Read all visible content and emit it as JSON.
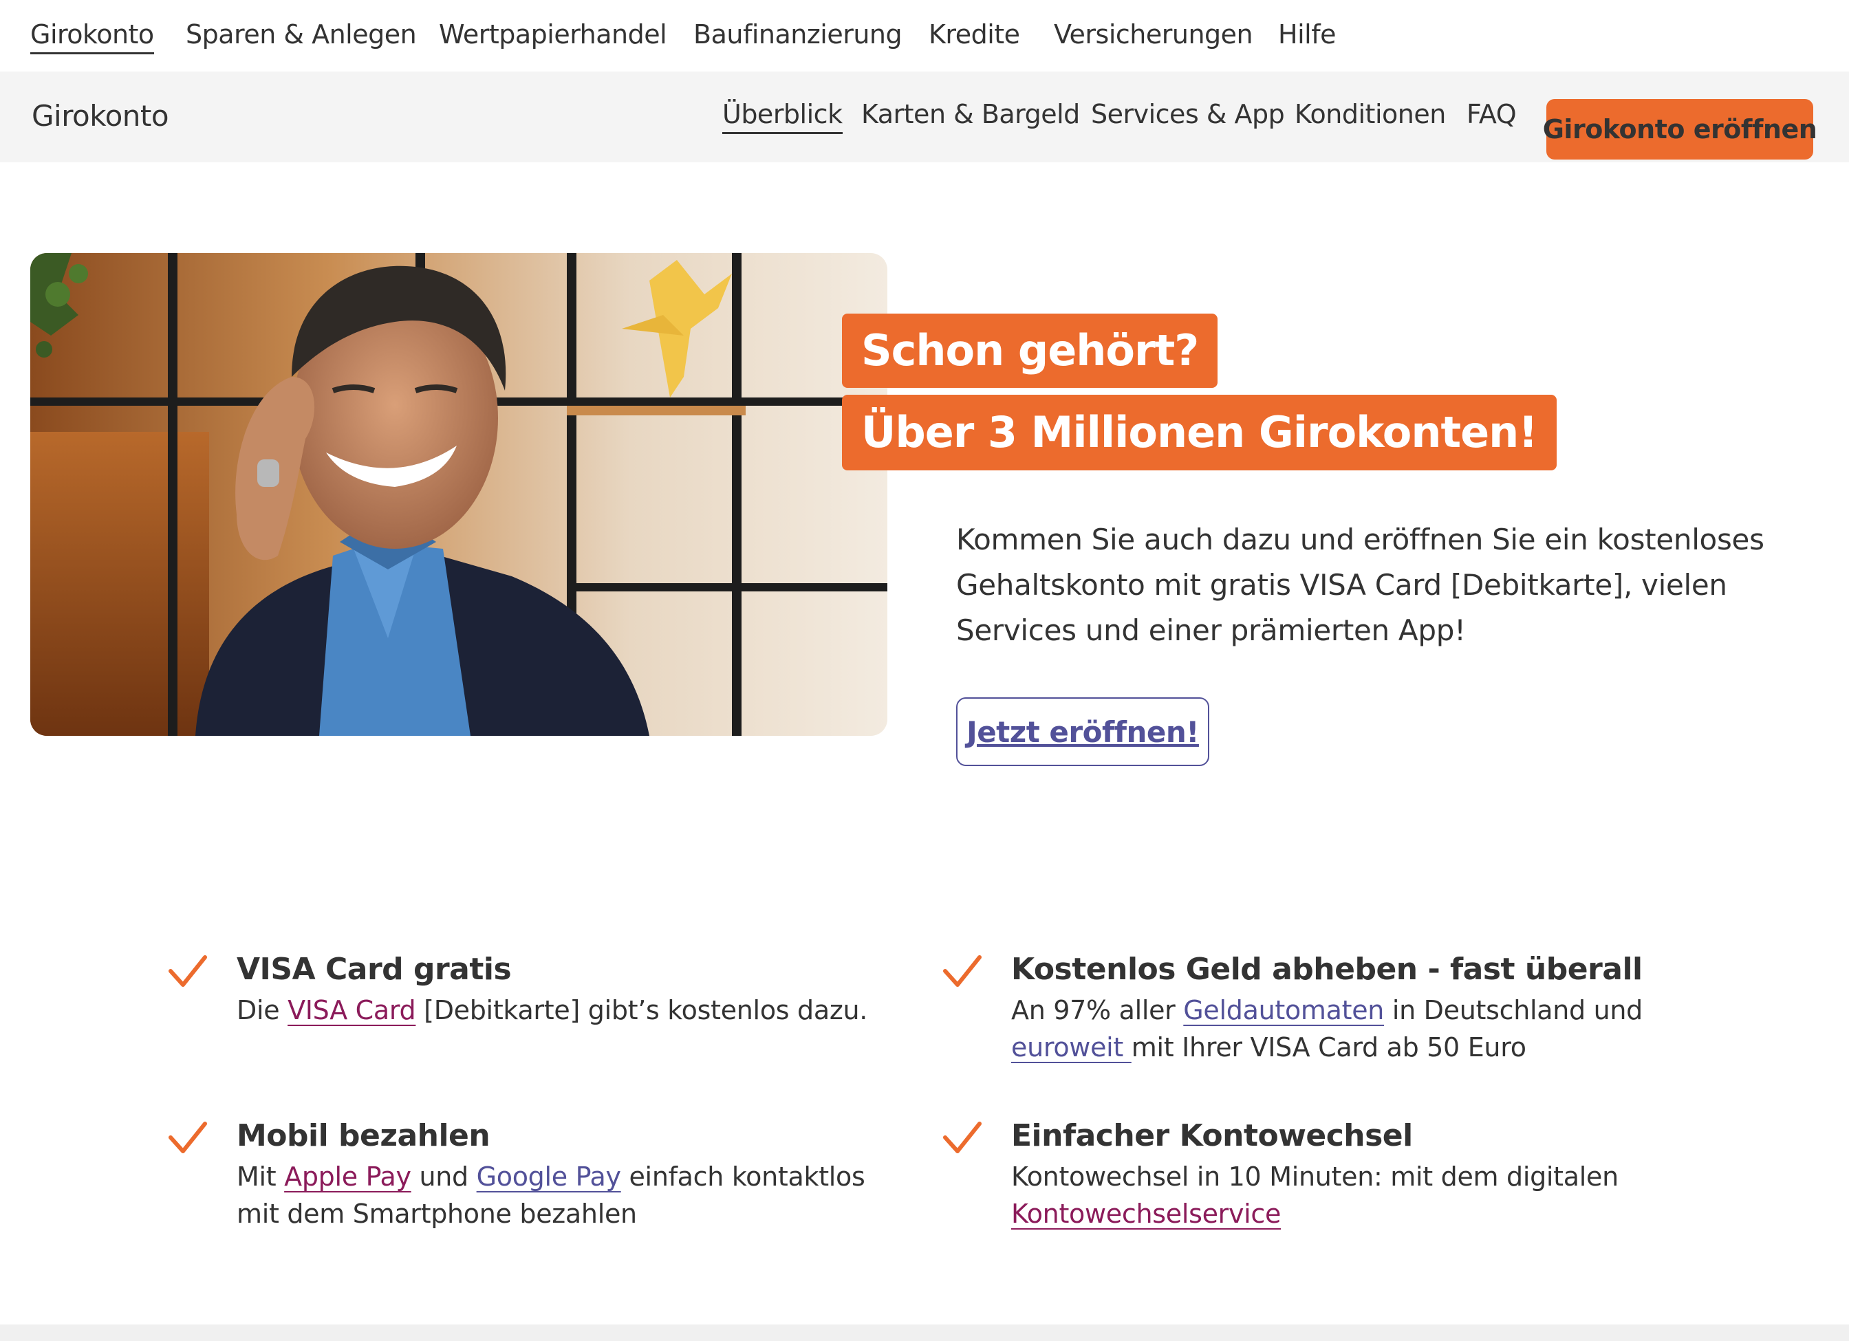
{
  "topnav": {
    "items": [
      {
        "label": "Girokonto"
      },
      {
        "label": "Sparen & Anlegen"
      },
      {
        "label": "Wertpapierhandel"
      },
      {
        "label": "Baufinanzierung"
      },
      {
        "label": "Kredite"
      },
      {
        "label": "Versicherungen"
      },
      {
        "label": "Hilfe"
      }
    ]
  },
  "subnav": {
    "title": "Girokonto",
    "items": [
      {
        "label": "Überblick"
      },
      {
        "label": "Karten & Bargeld"
      },
      {
        "label": "Services & App"
      },
      {
        "label": "Konditionen"
      },
      {
        "label": "FAQ"
      }
    ],
    "cta": "Girokonto eröffnen"
  },
  "hero": {
    "tag1": "Schon gehört?",
    "tag2": "Über 3 Millionen Girokonten!",
    "text": "Kommen Sie auch dazu und eröffnen Sie ein kostenloses Gehaltskonto mit gratis VISA Card [Debitkarte], vielen Services und einer prämierten App!",
    "button": "Jetzt eröffnen!"
  },
  "features": [
    {
      "title": "VISA Card gratis",
      "t1": "Die ",
      "link1": "VISA Card",
      "t2": " [Debitkarte] gibt’s kostenlos dazu."
    },
    {
      "title": "Kostenlos Geld abheben - fast überall",
      "t1": "An 97% aller ",
      "link1": "Geldautomaten",
      "t2": " in Deutschland und ",
      "link2": "euroweit ",
      "t3": "mit Ihrer VISA Card ab 50 Euro"
    },
    {
      "title": "Mobil bezahlen",
      "t1": "Mit ",
      "link1": "Apple Pay",
      "t2": " und ",
      "link2": "Google Pay",
      "t3": " einfach kontaktlos mit dem Smartphone bezahlen"
    },
    {
      "title": "Einfacher Kontowechsel",
      "t1": "Kontowechsel in 10 Minuten: mit dem digitalen ",
      "link1": "Kontowechselservice"
    }
  ],
  "colors": {
    "accent": "#ec6b2d",
    "link_indigo": "#525199",
    "link_purple": "#8b1b5a",
    "subnav_bg": "#f4f4f4"
  },
  "icons": {
    "feature_bullet": "check-icon"
  }
}
